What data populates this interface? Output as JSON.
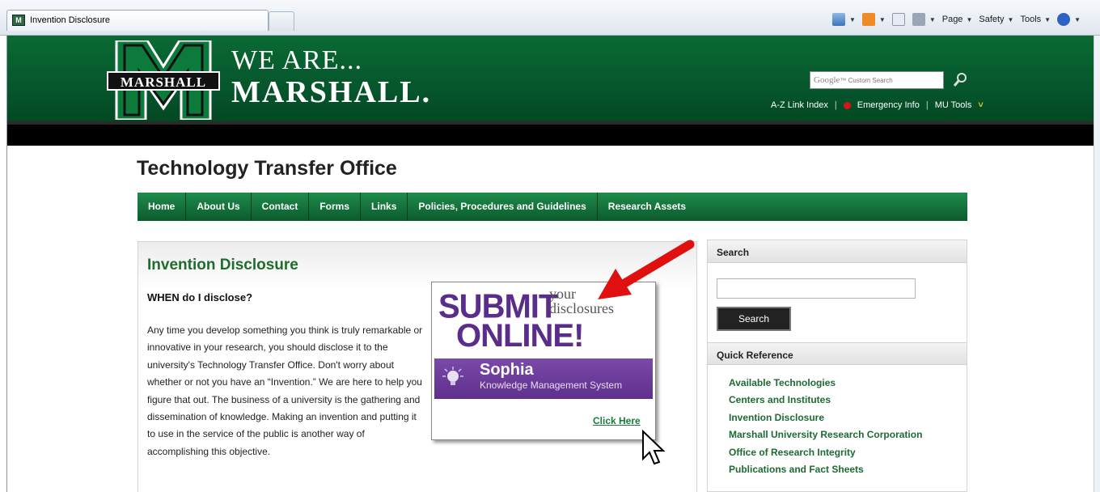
{
  "browser": {
    "tab_title": "Invention Disclosure",
    "favicon_text": "M",
    "commands": {
      "page": "Page",
      "safety": "Safety",
      "tools": "Tools"
    }
  },
  "header": {
    "logo_text": "MARSHALL",
    "tagline_line1": "WE ARE...",
    "tagline_line2": "MARSHALL.",
    "search_placeholder": "Google",
    "search_placeholder_suffix": "™ Custom Search",
    "util_links": {
      "az": "A-Z Link Index",
      "emergency": "Emergency Info",
      "mutools": "MU Tools"
    }
  },
  "page": {
    "title": "Technology Transfer Office",
    "nav": [
      "Home",
      "About Us",
      "Contact",
      "Forms",
      "Links",
      "Policies, Procedures and Guidelines",
      "Research Assets"
    ]
  },
  "main": {
    "title": "Invention Disclosure",
    "subheading": "WHEN do I disclose?",
    "body": "Any time you develop something you think is truly remarkable or innovative in your research, you should disclose it to the university's Technology Transfer Office. Don't worry about whether or not you have an “Invention.” We are here to help you figure that out. The business of a university is the gathering and dissemination of knowledge. Making an invention and putting it to use in the service of the public is another way of accomplishing this objective.",
    "promo": {
      "submit": "SUBMIT",
      "your": "your",
      "disclosures": "disclosures",
      "online": "ONLINE!",
      "sophia": "Sophia",
      "sophia_sub": "Knowledge Management System",
      "click_here": "Click Here"
    }
  },
  "sidebar": {
    "search_head": "Search",
    "search_button": "Search",
    "quick_head": "Quick Reference",
    "quick_links": [
      "Available Technologies",
      "Centers and Institutes",
      "Invention Disclosure",
      "Marshall University Research Corporation",
      "Office of Research Integrity",
      "Publications and Fact Sheets"
    ]
  },
  "colors": {
    "brand_green": "#05522a",
    "link_green": "#1d6a33",
    "promo_purple": "#5a2d8a",
    "arrow_red": "#e01010"
  }
}
